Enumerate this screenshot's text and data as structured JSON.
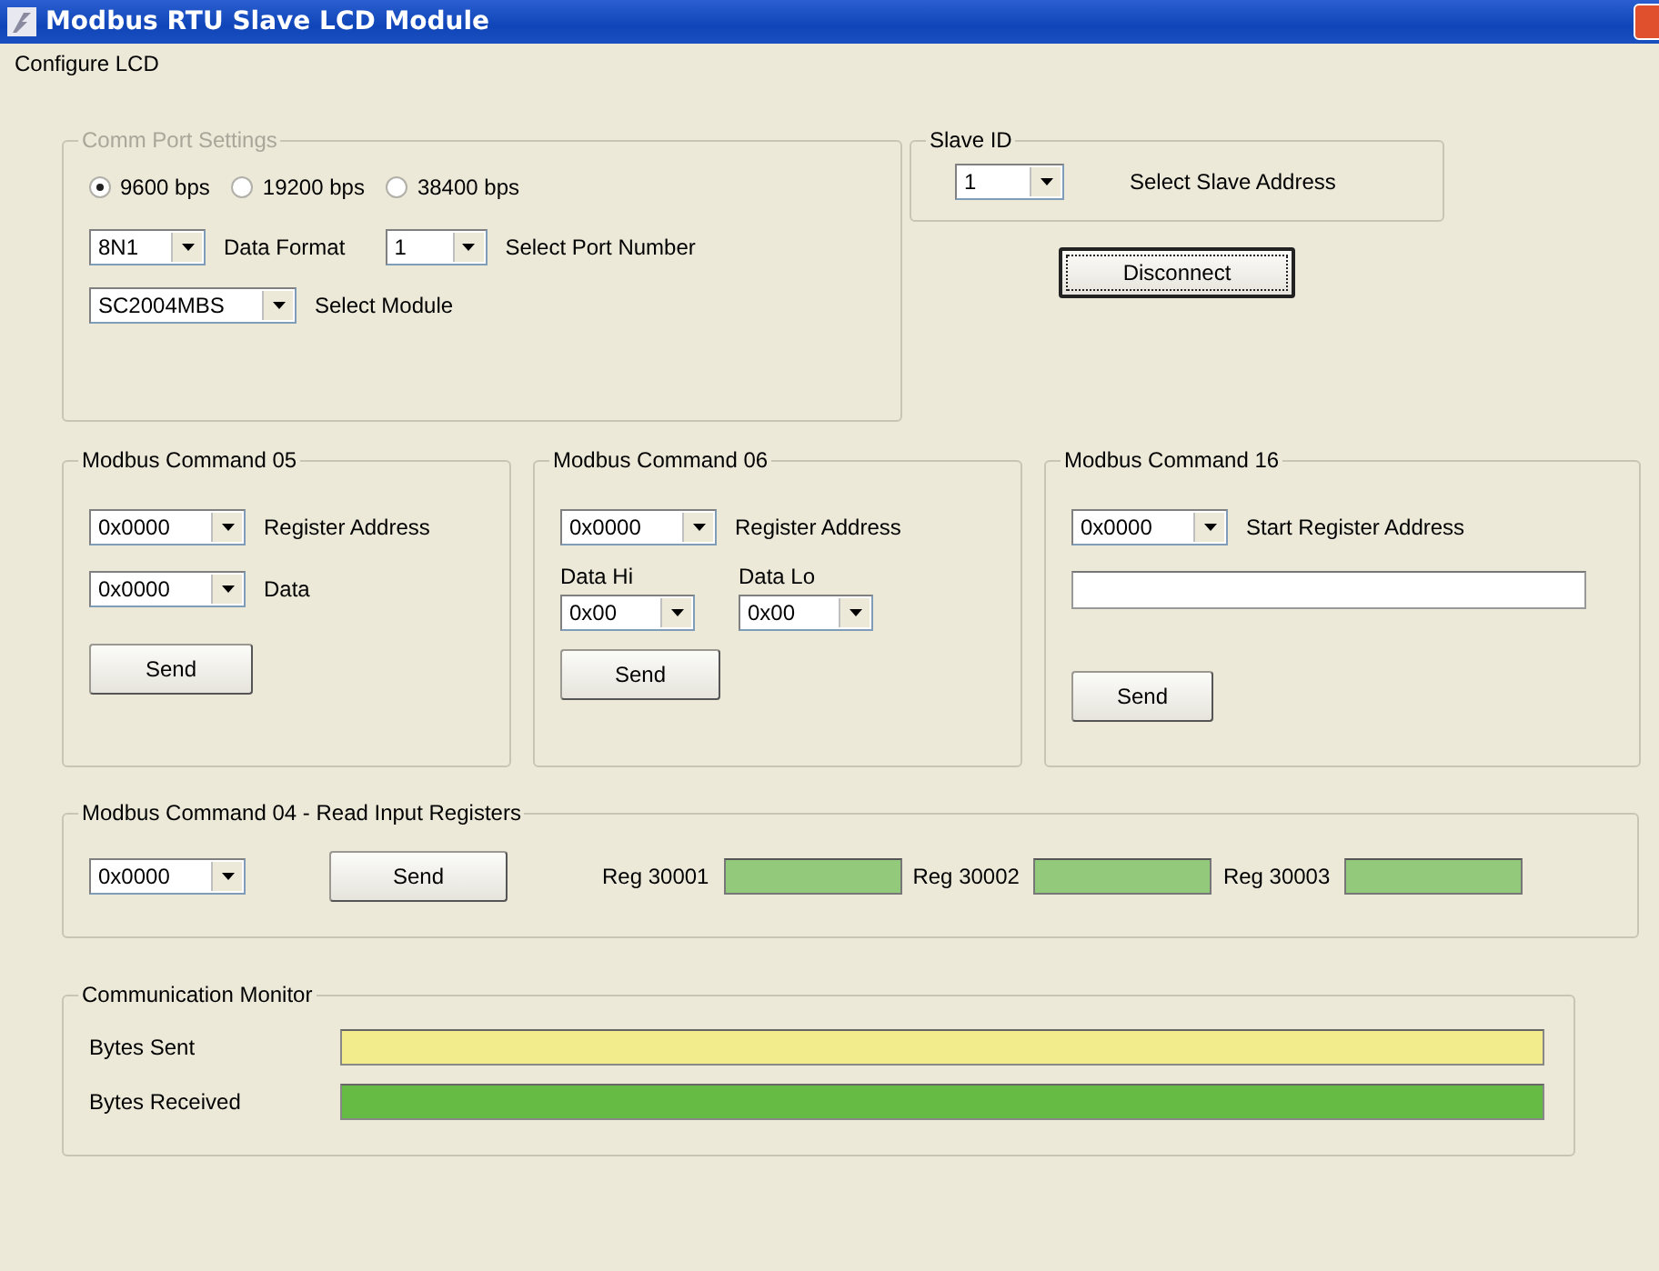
{
  "window": {
    "title": "Modbus RTU Slave LCD Module"
  },
  "menu": [
    {
      "label": "Configure LCD"
    }
  ],
  "comm_port": {
    "title": "Comm Port Settings",
    "disabled": true,
    "baud": [
      {
        "label": "9600 bps",
        "selected": true
      },
      {
        "label": "19200 bps",
        "selected": false
      },
      {
        "label": "38400 bps",
        "selected": false
      }
    ],
    "data_format": {
      "value": "8N1",
      "label": "Data Format"
    },
    "port": {
      "value": "1",
      "label": "Select Port Number"
    },
    "module": {
      "value": "SC2004MBS",
      "label": "Select Module"
    }
  },
  "slave_id": {
    "title": "Slave ID",
    "value": "1",
    "label": "Select Slave Address"
  },
  "disconnect_button": {
    "label": "Disconnect",
    "focused": true
  },
  "command_05": {
    "title": "Modbus Command 05",
    "register": {
      "value": "0x0000",
      "label": "Register Address"
    },
    "data": {
      "value": "0x0000",
      "label": "Data"
    },
    "button": "Send"
  },
  "command_06": {
    "title": "Modbus Command 06",
    "register": {
      "value": "0x0000",
      "label": "Register Address"
    },
    "data_hi": {
      "label": "Data Hi",
      "value": "0x00"
    },
    "data_lo": {
      "label": "Data Lo",
      "value": "0x00"
    },
    "button": "Send"
  },
  "command_16": {
    "title": "Modbus Command 16",
    "register": {
      "value": "0x0000",
      "label": "Start Register Address"
    },
    "button": "Send"
  },
  "command_04": {
    "title": "Modbus Command 04 - Read Input Registers",
    "register": {
      "value": "0x0000"
    },
    "button": "Send",
    "registers": [
      {
        "label": "Reg 30001"
      },
      {
        "label": "Reg 30002"
      },
      {
        "label": "Reg 30003"
      }
    ]
  },
  "monitor": {
    "title": "Communication Monitor",
    "rows": [
      {
        "label": "Bytes Sent",
        "color": "#f2ec8c"
      },
      {
        "label": "Bytes Received",
        "color": "#66bb44"
      }
    ]
  }
}
